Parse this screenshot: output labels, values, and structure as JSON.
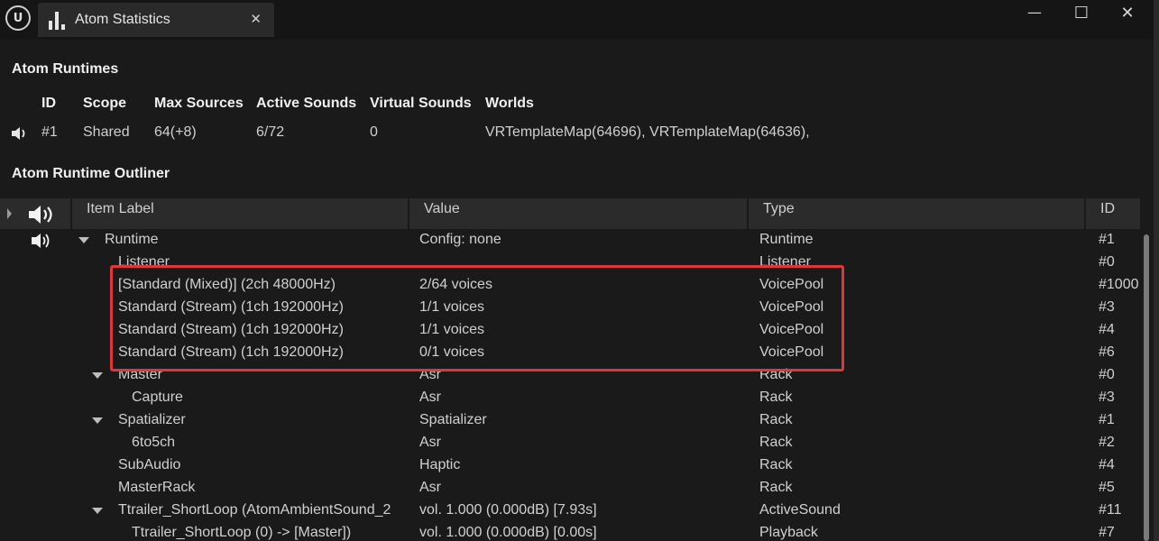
{
  "window": {
    "tab_title": "Atom Statistics",
    "close_glyph": "✕",
    "minimize_glyph": "—",
    "maximize_glyph": "☐",
    "window_close_glyph": "✕"
  },
  "runtimes": {
    "title": "Atom Runtimes",
    "headers": [
      "ID",
      "Scope",
      "Max Sources",
      "Active Sounds",
      "Virtual Sounds",
      "Worlds"
    ],
    "row": {
      "id": "#1",
      "scope": "Shared",
      "max_sources": "64(+8)",
      "active_sounds": "6/72",
      "virtual_sounds": "0",
      "worlds": "VRTemplateMap(64696), VRTemplateMap(64636),"
    }
  },
  "outliner": {
    "title": "Atom Runtime Outliner",
    "columns": {
      "label": "Item Label",
      "value": "Value",
      "type": "Type",
      "id": "ID"
    },
    "rows": [
      {
        "label": "Runtime",
        "value": "Config: none",
        "type": "Runtime",
        "id": "#1"
      },
      {
        "label": "Listener",
        "value": "",
        "type": "Listener",
        "id": "#0"
      },
      {
        "label": "[Standard (Mixed)]  (2ch 48000Hz)",
        "value": "2/64 voices",
        "type": "VoicePool",
        "id": "#1000"
      },
      {
        "label": "Standard (Stream)  (1ch 192000Hz)",
        "value": "1/1 voices",
        "type": "VoicePool",
        "id": "#3"
      },
      {
        "label": "Standard (Stream)  (1ch 192000Hz)",
        "value": "1/1 voices",
        "type": "VoicePool",
        "id": "#4"
      },
      {
        "label": "Standard (Stream)  (1ch 192000Hz)",
        "value": "0/1 voices",
        "type": "VoicePool",
        "id": "#6"
      },
      {
        "label": "Master",
        "value": "Asr",
        "type": "Rack",
        "id": "#0"
      },
      {
        "label": "Capture",
        "value": "Asr",
        "type": "Rack",
        "id": "#3"
      },
      {
        "label": "Spatializer",
        "value": "Spatializer",
        "type": "Rack",
        "id": "#1"
      },
      {
        "label": "6to5ch",
        "value": "Asr",
        "type": "Rack",
        "id": "#2"
      },
      {
        "label": "SubAudio",
        "value": "Haptic",
        "type": "Rack",
        "id": "#4"
      },
      {
        "label": "MasterRack",
        "value": "Asr",
        "type": "Rack",
        "id": "#5"
      },
      {
        "label": "Ttrailer_ShortLoop (AtomAmbientSound_2",
        "value": "vol. 1.000 (0.000dB) [7.93s]",
        "type": "ActiveSound",
        "id": "#11"
      },
      {
        "label": "Ttrailer_ShortLoop (0)   -> [Master])",
        "value": "vol. 1.000 (0.000dB) [0.00s]",
        "type": "Playback",
        "id": "#7"
      }
    ]
  },
  "colors": {
    "highlight": "#e0353a",
    "background": "#1a1a1a",
    "header": "#2b2b2b"
  }
}
